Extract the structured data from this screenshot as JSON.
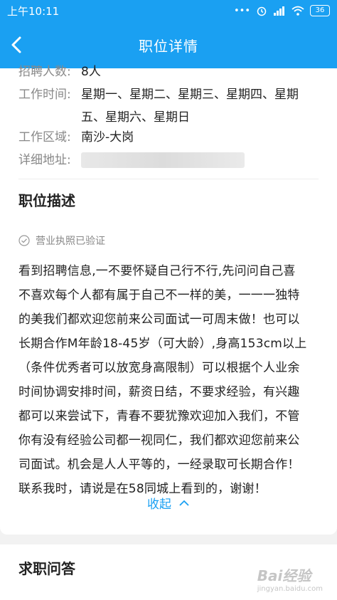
{
  "status_bar": {
    "time": "上午10:11",
    "signal": "•••",
    "battery": "36"
  },
  "nav": {
    "title": "职位详情"
  },
  "info": {
    "headcount_label": "招聘人数:",
    "headcount_value": "8人",
    "worktime_label": "工作时间:",
    "worktime_line1": "星期一、星期二、星期三、星期四、星期",
    "worktime_line2": "五、星期六、星期日",
    "area_label": "工作区域:",
    "area_value": "南沙-大岗",
    "address_label": "详细地址:"
  },
  "description": {
    "title": "职位描述",
    "verified": "营业执照已验证",
    "lines": [
      "看到招聘信息,一不要怀疑自己行不行,先问问自己喜",
      "不喜欢每个人都有属于自己不一样的美，一一一独特",
      "的美我们都欢迎您前来公司面试一可周末做！也可以",
      "长期合作M年龄18-45岁（可大龄）,身高153cm以上",
      "（条件优秀者可以放宽身高限制）可以根据个人业余",
      "时间协调安排时间，薪资日结，不要求经验，有兴趣",
      "都可以来尝试下，青春不要犹豫欢迎加入我们，不管",
      "你有没有经验公司都一视同仁，我们都欢迎您前来公",
      "司面试。机会是人人平等的，一经录取可长期合作！",
      "联系我时，请说是在58同城上看到的，谢谢！"
    ],
    "collapse_label": "收起"
  },
  "qa": {
    "title": "求职问答"
  },
  "watermark": {
    "main": "Bai经验",
    "sub": "jingyan.baidu.com"
  }
}
